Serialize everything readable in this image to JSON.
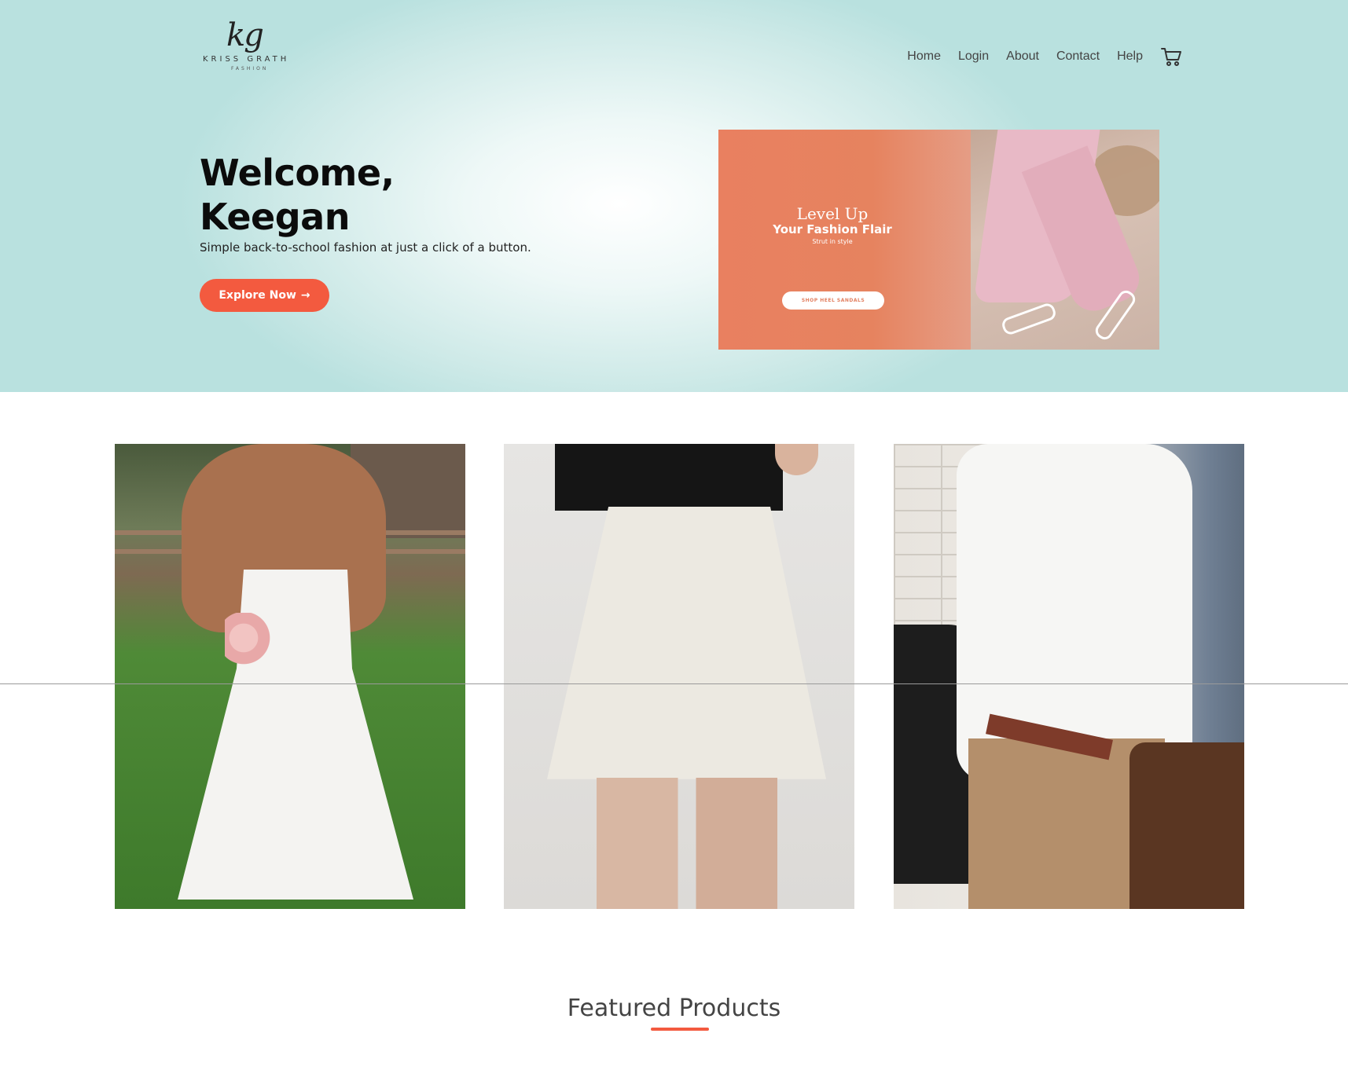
{
  "header": {
    "logo": {
      "monogram": "kg",
      "wordmark": "KRISS GRATH",
      "sub": "FASHION"
    },
    "nav": [
      {
        "label": "Home"
      },
      {
        "label": "Login"
      },
      {
        "label": "About"
      },
      {
        "label": "Contact"
      },
      {
        "label": "Help"
      }
    ],
    "cart_icon": "cart-icon"
  },
  "hero": {
    "greeting": "Welcome,",
    "name": "Keegan",
    "tagline": "Simple back-to-school fashion at just a click of a button.",
    "cta_label": "Explore Now",
    "cta_arrow": "→",
    "cta_color": "#f35a3f"
  },
  "banner": {
    "line1": "Level Up",
    "line2": "Your Fashion Flair",
    "line3": "Strut in style",
    "button_label": "SHOP HEEL SANDALS",
    "bg_color": "#e98060"
  },
  "gallery": [
    {
      "alt": "white-dress-photo"
    },
    {
      "alt": "white-skirt-photo"
    },
    {
      "alt": "white-shirt-photo"
    }
  ],
  "featured": {
    "title": "Featured Products",
    "accent": "#f35a3f"
  }
}
